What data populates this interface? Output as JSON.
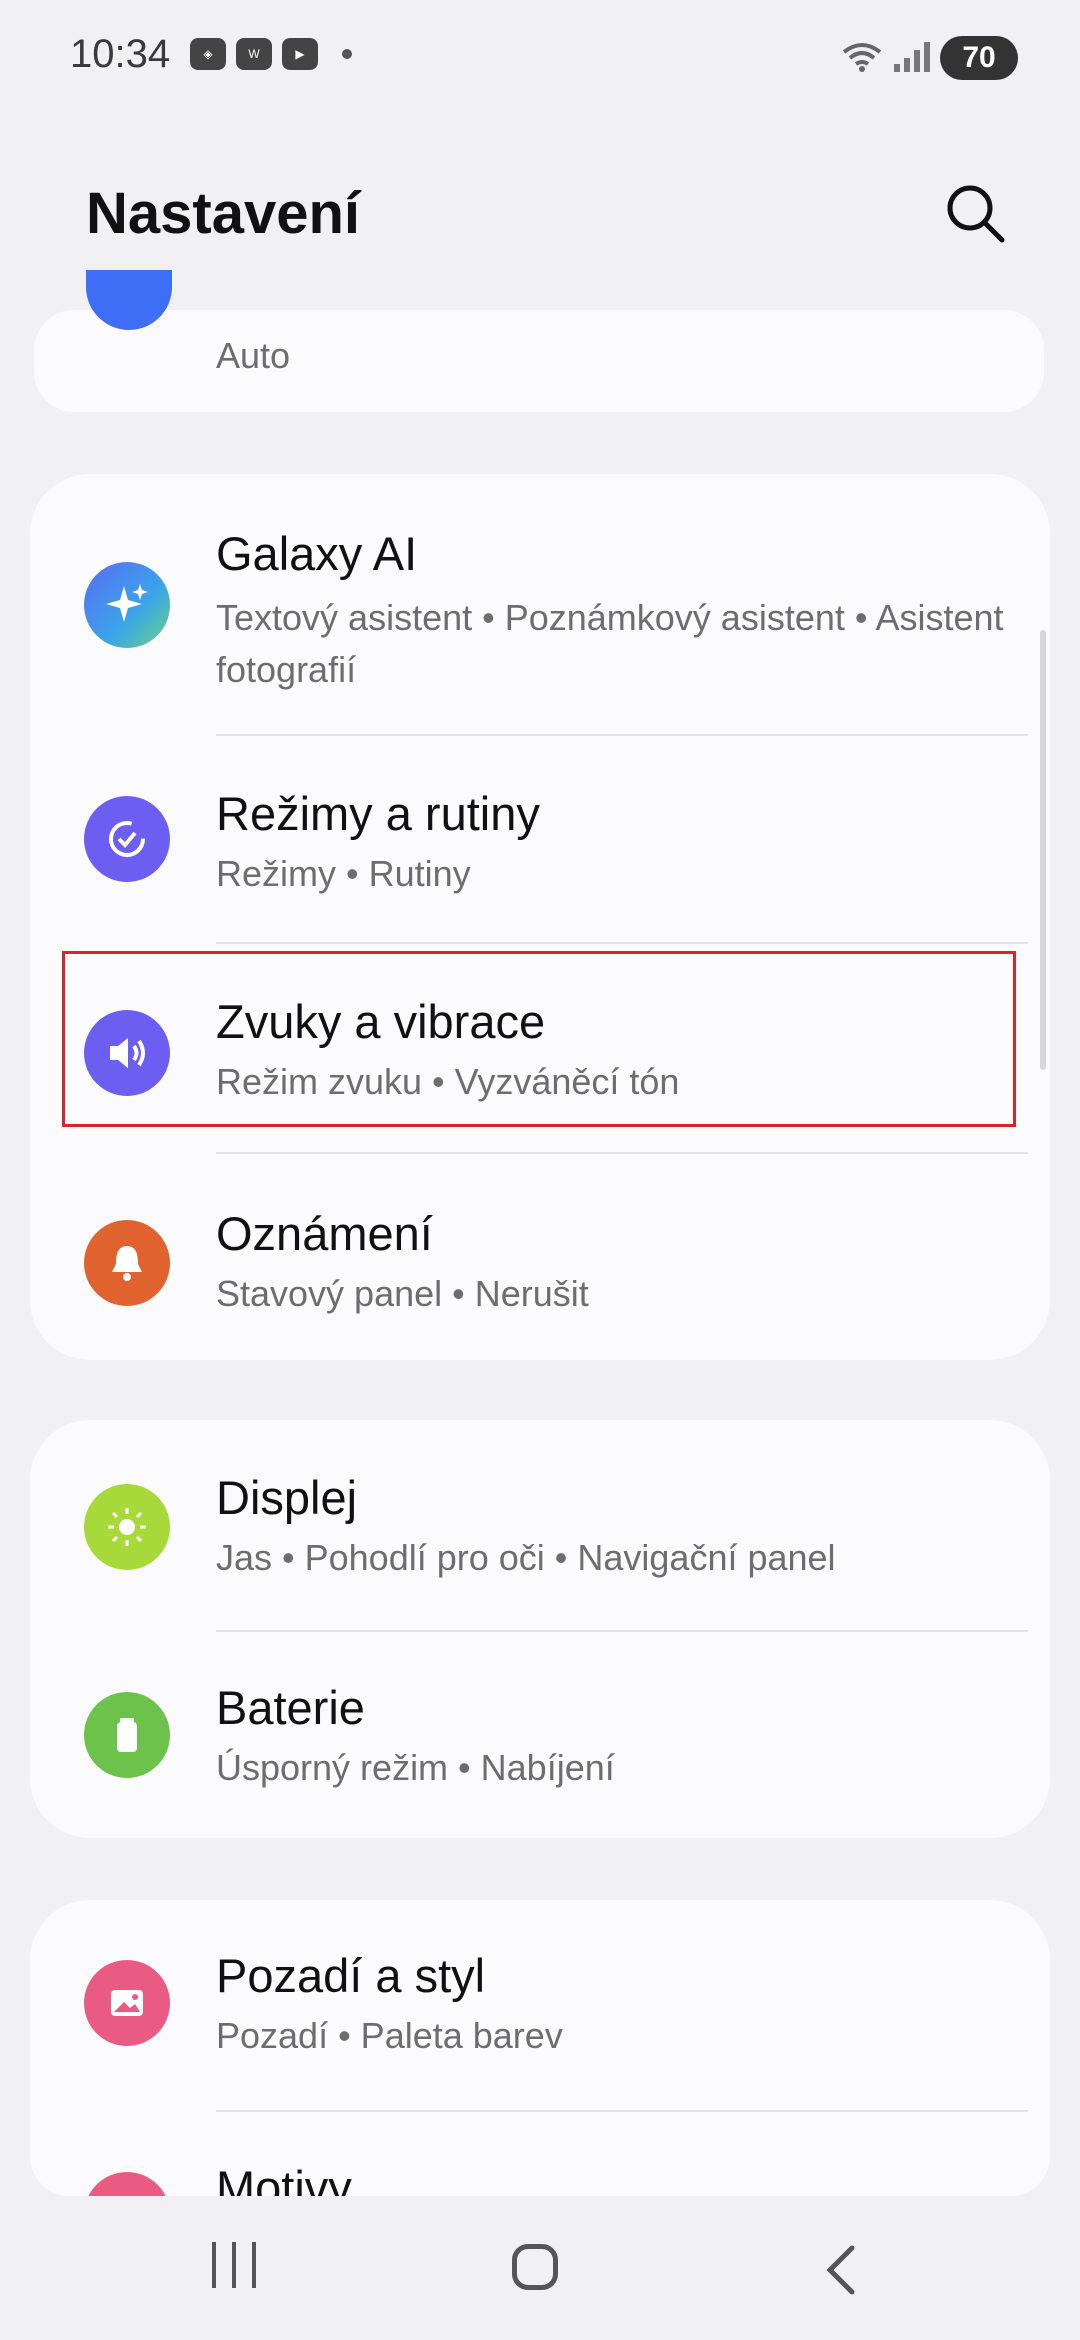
{
  "status_bar": {
    "time": "10:34",
    "battery": "70",
    "icons": [
      "app-icon",
      "wear-icon",
      "youtube-icon",
      "dot-icon",
      "wifi-icon",
      "signal-icon",
      "battery-charging-icon"
    ]
  },
  "header": {
    "title": "Nastavení",
    "search_icon": "search-icon"
  },
  "top_partial": {
    "subtitle": "Auto",
    "icon_color": "#3d6ef5"
  },
  "sections": [
    {
      "items": [
        {
          "title": "Galaxy AI",
          "subtitle": "Textový asistent  •  Poznámkový asistent  •  Asistent fotografií",
          "icon": "sparkles-icon",
          "color": "#4b8df8"
        },
        {
          "title": "Režimy a rutiny",
          "subtitle": "Režimy  •  Rutiny",
          "icon": "modes-check-icon",
          "color": "#6b5ef0"
        },
        {
          "title": "Zvuky a vibrace",
          "subtitle": "Režim zvuku  •  Vyzváněcí tón",
          "icon": "speaker-icon",
          "color": "#6b5ef0"
        },
        {
          "title": "Oznámení",
          "subtitle": "Stavový panel  •  Nerušit",
          "icon": "bell-icon",
          "color": "#e0632f"
        }
      ]
    },
    {
      "items": [
        {
          "title": "Displej",
          "subtitle": "Jas  •  Pohodlí pro oči  •  Navigační panel",
          "icon": "sun-icon",
          "color": "#a7d93b"
        },
        {
          "title": "Baterie",
          "subtitle": "Úsporný režim  •  Nabíjení",
          "icon": "battery-icon",
          "color": "#6cc24a"
        }
      ]
    },
    {
      "items": [
        {
          "title": "Pozadí a styl",
          "subtitle": "Pozadí  •  Paleta barev",
          "icon": "image-icon",
          "color": "#e95b83"
        },
        {
          "title": "Motivy",
          "subtitle": "",
          "icon": "themes-icon",
          "color": "#e95b83"
        }
      ]
    }
  ],
  "highlight_color": "#d7262b",
  "nav": {
    "recent": "recent-apps-icon",
    "home": "home-icon",
    "back": "back-icon"
  }
}
